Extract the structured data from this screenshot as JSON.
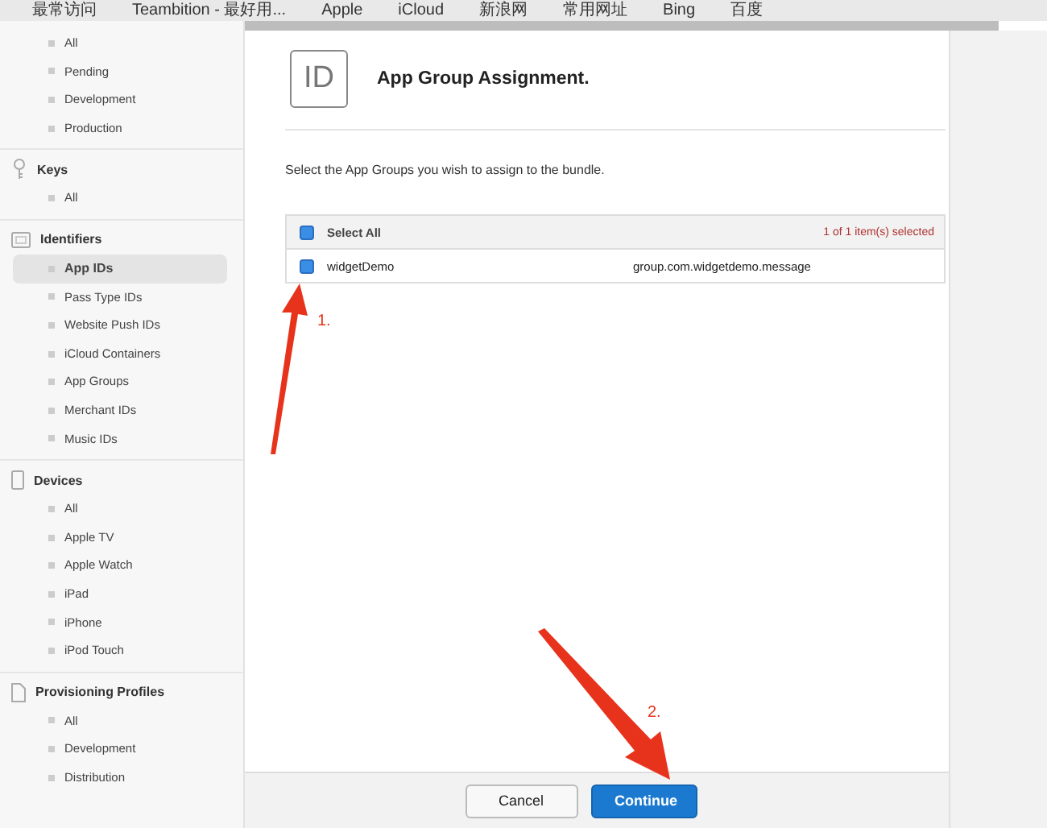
{
  "bookmarks": [
    {
      "label": "最常访问"
    },
    {
      "label": "Teambition - 最好用..."
    },
    {
      "label": "Apple"
    },
    {
      "label": "iCloud"
    },
    {
      "label": "新浪网"
    },
    {
      "label": "常用网址"
    },
    {
      "label": "Bing"
    },
    {
      "label": "百度"
    }
  ],
  "sidebar": {
    "sections": [
      {
        "items": [
          {
            "label": "All",
            "selected": false
          },
          {
            "label": "Pending",
            "selected": false
          },
          {
            "label": "Development",
            "selected": false
          },
          {
            "label": "Production",
            "selected": false
          }
        ]
      },
      {
        "kind": "key",
        "title": "Keys",
        "items": [
          {
            "label": "All",
            "selected": false
          }
        ]
      },
      {
        "kind": "id",
        "title": "Identifiers",
        "items": [
          {
            "label": "App IDs",
            "selected": true
          },
          {
            "label": "Pass Type IDs",
            "selected": false
          },
          {
            "label": "Website Push IDs",
            "selected": false
          },
          {
            "label": "iCloud Containers",
            "selected": false
          },
          {
            "label": "App Groups",
            "selected": false
          },
          {
            "label": "Merchant IDs",
            "selected": false
          },
          {
            "label": "Music IDs",
            "selected": false
          }
        ]
      },
      {
        "kind": "device",
        "title": "Devices",
        "items": [
          {
            "label": "All",
            "selected": false
          },
          {
            "label": "Apple TV",
            "selected": false
          },
          {
            "label": "Apple Watch",
            "selected": false
          },
          {
            "label": "iPad",
            "selected": false
          },
          {
            "label": "iPhone",
            "selected": false
          },
          {
            "label": "iPod Touch",
            "selected": false
          }
        ]
      },
      {
        "kind": "document",
        "title": "Provisioning Profiles",
        "items": [
          {
            "label": "All",
            "selected": false
          },
          {
            "label": "Development",
            "selected": false
          },
          {
            "label": "Distribution",
            "selected": false
          }
        ]
      }
    ]
  },
  "main": {
    "badge": "ID",
    "title": "App Group Assignment.",
    "instruction": "Select the App Groups you wish to assign to the bundle.",
    "table": {
      "select_all": {
        "label": "Select All",
        "checked": true
      },
      "count": "1 of 1 item(s) selected",
      "rows": [
        {
          "name": "widgetDemo",
          "identifier": "group.com.widgetdemo.message",
          "checked": true
        }
      ]
    },
    "buttons": [
      {
        "label": "Cancel",
        "kind": "secondary"
      },
      {
        "label": "Continue",
        "kind": "primary"
      }
    ]
  },
  "annotations": [
    {
      "label": "1.",
      "kind": "checkbox"
    },
    {
      "label": "2.",
      "kind": "continue"
    }
  ]
}
